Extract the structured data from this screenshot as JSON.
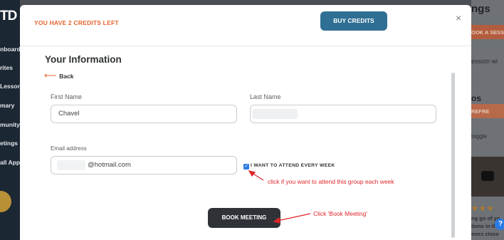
{
  "background": {
    "logo": "TD",
    "nav_items": [
      "nboard",
      "rites",
      "Lessons",
      "mary",
      "munity",
      "etings",
      "all App"
    ],
    "right_panel": {
      "title": "ngs",
      "book_button": "OOK A SESS",
      "text1": "ession wi",
      "section": "os",
      "refresh_button": "REFRE",
      "toggle_text": "toggle",
      "blurb": [
        "ng go of yo",
        "tions in th",
        "ones close"
      ],
      "stars": "★★★"
    },
    "help_label": "?"
  },
  "modal": {
    "credits_text": "YOU HAVE 2 CREDITS LEFT",
    "buy_button": "BUY CREDITS",
    "close_label": "×",
    "section_title": "Your Information",
    "back_label": "Back",
    "first_name_label": "First Name",
    "first_name_value": "Chavel",
    "last_name_label": "Last Name",
    "last_name_value": "",
    "email_label": "Email address",
    "email_value": "@hotmail.com",
    "weekly_checkbox_label": "I WANT TO ATTEND EVERY WEEK",
    "weekly_checked": true,
    "book_button": "BOOK MEETING"
  },
  "annotations": {
    "weekly_hint": "click if you want to attend this group each week",
    "book_hint": "Click 'Book Meeting'",
    "color": "#e0262b"
  },
  "colors": {
    "accent_orange": "#e3622f",
    "buy_button": "#2f6f93",
    "book_button": "#2f3337",
    "checkbox": "#2a7be4"
  }
}
